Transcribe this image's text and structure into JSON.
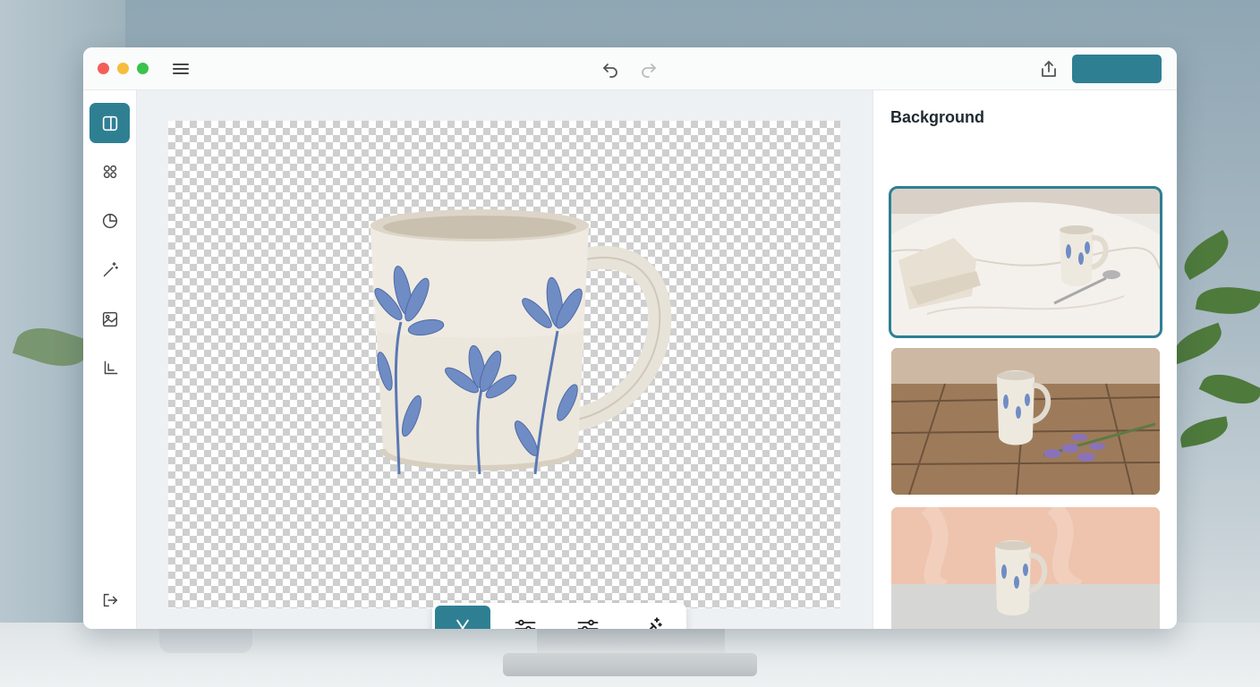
{
  "window": {
    "traffic_lights": [
      "close",
      "minimize",
      "zoom"
    ],
    "toolbar": {
      "menu_icon": "hamburger-menu-icon",
      "undo_icon": "undo-icon",
      "redo_icon": "redo-icon",
      "share_icon": "share-icon",
      "primary_button_label": ""
    }
  },
  "rail": {
    "items": [
      {
        "name": "layout-panel",
        "icon": "layout-panel-icon",
        "active": true
      },
      {
        "name": "command",
        "icon": "command-icon",
        "active": false
      },
      {
        "name": "pie-chart",
        "icon": "pie-chart-icon",
        "active": false
      },
      {
        "name": "magic-wand",
        "icon": "magic-wand-icon",
        "active": false
      },
      {
        "name": "image",
        "icon": "image-icon",
        "active": false
      },
      {
        "name": "crop",
        "icon": "crop-icon",
        "active": false
      }
    ],
    "logout_icon": "logout-icon"
  },
  "canvas": {
    "tools": [
      {
        "name": "cut",
        "icon": "scissors-icon",
        "active": true
      },
      {
        "name": "adjust",
        "icon": "sliders-icon",
        "active": false
      },
      {
        "name": "filters",
        "icon": "sliders-alt-icon",
        "active": false
      },
      {
        "name": "enhance",
        "icon": "magic-wand-icon",
        "active": false
      }
    ]
  },
  "panel": {
    "title": "Background",
    "thumbnails": [
      {
        "scene": "marble-table-with-napkin-and-spoon",
        "selected": true
      },
      {
        "scene": "wooden-table-with-lavender",
        "selected": false
      },
      {
        "scene": "peach-wall-grey-surface",
        "selected": false
      }
    ]
  },
  "colors": {
    "accent": "#2f7f93",
    "close": "#f25f58",
    "minimize": "#f6bd3b",
    "zoom": "#3bc24b"
  }
}
